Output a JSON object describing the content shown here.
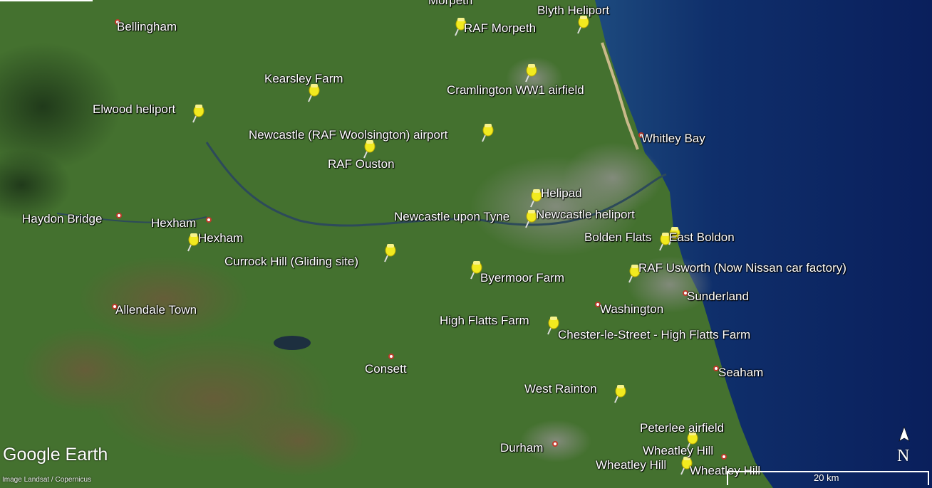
{
  "branding": {
    "logo": "Google Earth",
    "credit": "Image Landsat / Copernicus"
  },
  "compass": {
    "letter": "N",
    "icon": "north-arrow-icon"
  },
  "scale": {
    "label": "20 km"
  },
  "colors": {
    "land": "#3f6a2e",
    "sea": "#0b2a66",
    "pin": "#f2ea1f",
    "town_dot": "#c0392b"
  },
  "towns": [
    "Morpeth",
    "Bellingham",
    "Whitley Bay",
    "Haydon Bridge",
    "Hexham",
    "Allendale Town",
    "Consett",
    "Washington",
    "Sunderland",
    "Seaham",
    "Durham",
    "Newcastle upon Tyne"
  ],
  "placemarks": [
    "RAF Morpeth",
    "Blyth Heliport",
    "Cramlington WW1 airfield",
    "Kearsley Farm",
    "Elwood heliport",
    "Newcastle (RAF Woolsington) airport",
    "RAF Ouston",
    "Helipad",
    "Newcastle heliport",
    "Hexham",
    "Currock Hill (Gliding site)",
    "Bolden Flats",
    "East Boldon",
    "RAF Usworth  (Now Nissan car factory)",
    "Byermoor Farm",
    "High Flatts Farm",
    "Chester-le-Street - High Flatts Farm",
    "West Rainton",
    "Peterlee airfield",
    "Wheatley Hill",
    "Wheatley Hill",
    "Wheatley Hill"
  ]
}
